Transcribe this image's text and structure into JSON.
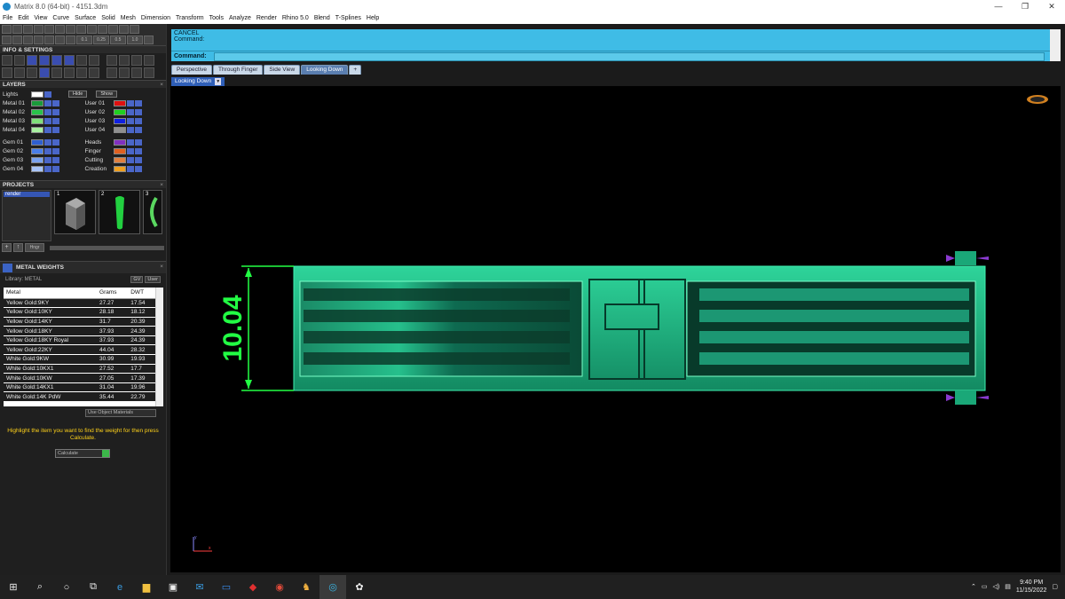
{
  "window": {
    "title": "Matrix 8.0 (64-bit) - 4151.3dm",
    "controls": [
      "—",
      "❐",
      "✕"
    ]
  },
  "menu": [
    "File",
    "Edit",
    "View",
    "Curve",
    "Surface",
    "Solid",
    "Mesh",
    "Dimension",
    "Transform",
    "Tools",
    "Analyze",
    "Render",
    "Rhino 5.0",
    "Blend",
    "T-Splines",
    "Help"
  ],
  "toolbar": {
    "snap_values": [
      "0.1",
      "0.25",
      "0.5",
      "1.0"
    ]
  },
  "info_settings": {
    "title": "INFO & SETTINGS"
  },
  "layers": {
    "title": "LAYERS",
    "lights_label": "Lights",
    "hide_label": "Hide",
    "show_label": "Show",
    "left_col": [
      {
        "name": "Metal 01",
        "color": "#1a9a3a"
      },
      {
        "name": "Metal 02",
        "color": "#29c24a"
      },
      {
        "name": "Metal 03",
        "color": "#7fe07a"
      },
      {
        "name": "Metal 04",
        "color": "#a8f0a0"
      },
      {
        "name": "Gem 01",
        "color": "#2f5fd0"
      },
      {
        "name": "Gem 02",
        "color": "#4a7ee8"
      },
      {
        "name": "Gem 03",
        "color": "#7aa2f0"
      },
      {
        "name": "Gem 04",
        "color": "#a8c4f8"
      }
    ],
    "right_col": [
      {
        "name": "User 01",
        "color": "#e01010"
      },
      {
        "name": "User 02",
        "color": "#20d020"
      },
      {
        "name": "User 03",
        "color": "#1020e0"
      },
      {
        "name": "User 04",
        "color": "#909090"
      },
      {
        "name": "Heads",
        "color": "#8030c0"
      },
      {
        "name": "Finger",
        "color": "#e06020"
      },
      {
        "name": "Cutting",
        "color": "#e08040"
      },
      {
        "name": "Creation",
        "color": "#f0a020"
      }
    ]
  },
  "projects": {
    "title": "PROJECTS",
    "list": [
      "render"
    ],
    "thumbs": [
      "1",
      "2",
      "3"
    ],
    "hinge_label": "Hngr"
  },
  "metal_weights": {
    "title": "METAL WEIGHTS",
    "library_label": "Library: METAL",
    "lib_buttons": [
      "GV",
      "User"
    ],
    "columns": [
      "Metal",
      "Grams",
      "DWT"
    ],
    "rows": [
      [
        "Yellow Gold:9KY",
        "27.27",
        "17.54"
      ],
      [
        "Yellow Gold:10KY",
        "28.18",
        "18.12"
      ],
      [
        "Yellow Gold:14KY",
        "31.7",
        "20.39"
      ],
      [
        "Yellow Gold:18KY",
        "37.93",
        "24.39"
      ],
      [
        "Yellow Gold:18KY Royal",
        "37.93",
        "24.39"
      ],
      [
        "Yellow Gold:22KY",
        "44.04",
        "28.32"
      ],
      [
        "White Gold:9KW",
        "30.99",
        "19.93"
      ],
      [
        "White Gold:10KX1",
        "27.52",
        "17.7"
      ],
      [
        "White Gold:10KW",
        "27.05",
        "17.39"
      ],
      [
        "White Gold:14KX1",
        "31.04",
        "19.96"
      ],
      [
        "White Gold:14K PdW",
        "35.44",
        "22.79"
      ]
    ],
    "use_object_materials": "Use Object Materials",
    "hint": "Highlight the item you want to find the weight for then press Calculate.",
    "calculate": "Calculate"
  },
  "command": {
    "line1": "CANCEL",
    "line2": "Command:",
    "prompt": "Command:"
  },
  "tabs": [
    "Perspective",
    "Through Finger",
    "Side View",
    "Looking Down",
    "+"
  ],
  "active_tab": "Looking Down",
  "viewport": {
    "label": "Looking Down",
    "dimension": "10.04",
    "axis_y": "y",
    "axis_x": "x"
  },
  "taskbar": {
    "time": "9:40 PM",
    "date": "11/15/2022"
  }
}
